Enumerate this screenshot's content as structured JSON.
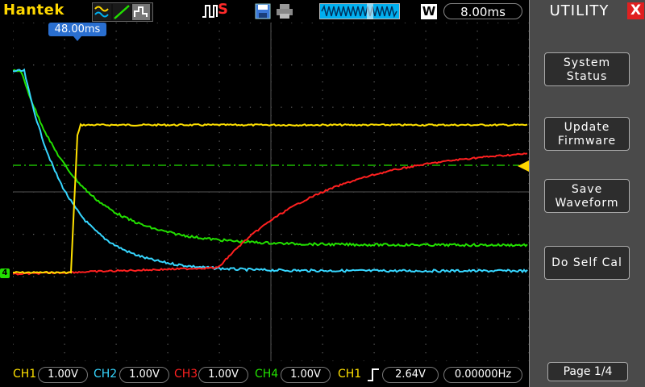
{
  "brand": "Hantek",
  "toolbar": {
    "run_state": "S",
    "timebase_mode": "W",
    "timebase": "8.00ms"
  },
  "trigger": {
    "position_label": "48.00ms",
    "source": "CH1",
    "level": "2.64V",
    "frequency": "0.00000Hz"
  },
  "channels": [
    {
      "name": "CH1",
      "scale": "1.00V",
      "color": "#ffe100"
    },
    {
      "name": "CH2",
      "scale": "1.00V",
      "color": "#36d6ff"
    },
    {
      "name": "CH3",
      "scale": "1.00V",
      "color": "#ff2020"
    },
    {
      "name": "CH4",
      "scale": "1.00V",
      "color": "#22e000"
    }
  ],
  "ch4_marker": "4",
  "menu": {
    "title": "UTILITY",
    "close": "X",
    "buttons": [
      {
        "line1": "System",
        "line2": "Status"
      },
      {
        "line1": "Update",
        "line2": "Firmware"
      },
      {
        "line1": "Save",
        "line2": "Waveform"
      },
      {
        "line1": "Do Self Cal",
        "line2": ""
      }
    ],
    "page": "Page 1/4"
  }
}
